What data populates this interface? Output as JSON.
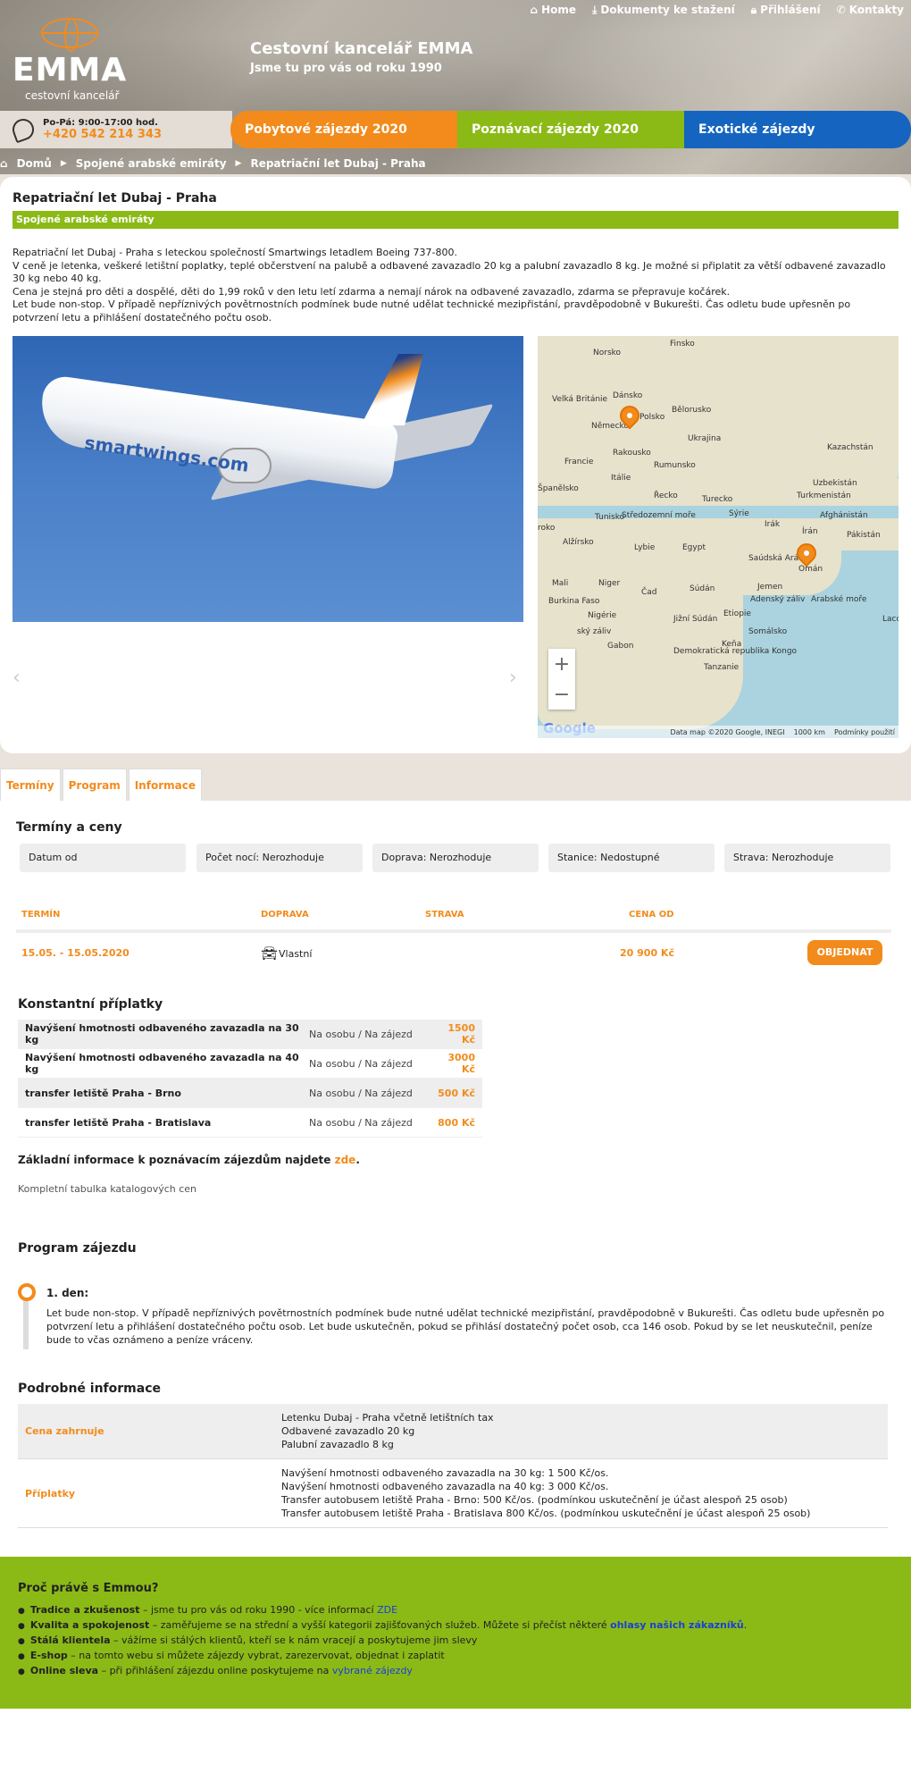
{
  "topnav": [
    {
      "label": "Home",
      "icon": "home-icon"
    },
    {
      "label": "Dokumenty ke stažení",
      "icon": "download-icon"
    },
    {
      "label": "Přihlášení",
      "icon": "lock-icon"
    },
    {
      "label": "Kontakty",
      "icon": "phone-icon"
    }
  ],
  "logo": {
    "word": "EMMA",
    "sub": "cestovní kancelář"
  },
  "header": {
    "title": "Cestovní kancelář EMMA",
    "subtitle": "Jsme tu pro vás od roku 1990"
  },
  "contact": {
    "hours": "Po-Pá: 9:00-17:00 hod.",
    "phone": "+420 542 214 343"
  },
  "mainnav": [
    "Pobytové zájezdy 2020",
    "Poznávací zájezdy 2020",
    "Exotické zájezdy"
  ],
  "crumbs": [
    "Domů",
    "Spojené arabské emiráty",
    "Repatriační let Dubaj - Praha"
  ],
  "page": {
    "title": "Repatriační let Dubaj - Praha",
    "country": "Spojené arabské emiráty",
    "desc": [
      "Repatriační let Dubaj - Praha s leteckou společností Smartwings letadlem Boeing 737-800.",
      "V ceně je letenka, veškeré letištní poplatky, teplé občerstvení na palubě a odbavené zavazadlo 20 kg a palubní zavazadlo 8 kg. Je možné si připlatit za větší odbavené zavazadlo 30 kg nebo 40 kg.",
      "Cena je stejná pro děti a dospělé, děti do 1,99 roků v den letu letí zdarma a nemají nárok na odbavené zavazadlo, zdarma se přepravuje kočárek.",
      "Let bude non-stop. V případě nepříznivých povětrnostních podmínek bude nutné udělat technické mezipřistání, pravděpodobně v Bukurešti. Čas odletu bude upřesněn po potvrzení letu a přihlášení dostatečného počtu osob."
    ]
  },
  "plane": {
    "livery": "smartwings.com"
  },
  "map": {
    "labels": [
      "Finsko",
      "Norsko",
      "Dánsko",
      "Velká Británie",
      "Bělorusko",
      "Německo",
      "Polsko",
      "Ukrajina",
      "Francie",
      "Rakousko",
      "Rumunsko",
      "Kazachstán",
      "Uzbekistán",
      "Španělsko",
      "Itálie",
      "Řecko",
      "Turecko",
      "Turkmenistán",
      "Sýrie",
      "Irák",
      "Afghánistán",
      "Tunisko",
      "Středozemní moře",
      "Írán",
      "Pákistán",
      "roko",
      "Alžírsko",
      "Lybie",
      "Egypt",
      "Saúdská Arábie",
      "Omán",
      "Mali",
      "Niger",
      "Čad",
      "Súdán",
      "Jemen",
      "Burkina Faso",
      "Nigérie",
      "Adenský záliv",
      "Arabské moře",
      "Jižní Súdán",
      "Etiopie",
      "Somálsko",
      "Keňa",
      "Gabon",
      "Demokratická republika Kongo",
      "Tanzanie",
      "Lacca",
      "ský záliv"
    ],
    "footer": [
      "Data map ©2020 Google, INEGI",
      "1000 km",
      "Podmínky použití"
    ],
    "google": "Google",
    "zoom_in": "+",
    "zoom_out": "−"
  },
  "tabs": [
    "Termíny",
    "Program",
    "Informace"
  ],
  "terms": {
    "heading": "Termíny a ceny",
    "filters": [
      "Datum od",
      "Počet nocí: Nerozhoduje",
      "Doprava: Nerozhoduje",
      "Stanice: Nedostupné",
      "Strava: Nerozhoduje"
    ],
    "cols": [
      "TERMÍN",
      "DOPRAVA",
      "STRAVA",
      "CENA OD"
    ],
    "row": {
      "date": "15.05. - 15.05.2020",
      "transport": "Vlastní",
      "price": "20 900 Kč",
      "button": "OBJEDNAT"
    }
  },
  "surcharges": {
    "heading": "Konstantní příplatky",
    "rows": [
      {
        "name": "Navýšení hmotnosti odbaveného zavazadla na 30 kg",
        "unit": "Na osobu / Na zájezd",
        "price": "1500 Kč"
      },
      {
        "name": "Navýšení hmotnosti odbaveného zavazadla na 40 kg",
        "unit": "Na osobu / Na zájezd",
        "price": "3000 Kč"
      },
      {
        "name": "transfer letiště Praha - Brno",
        "unit": "Na osobu / Na zájezd",
        "price": "500 Kč"
      },
      {
        "name": "transfer letiště Praha - Bratislava",
        "unit": "Na osobu / Na zájezd",
        "price": "800 Kč"
      }
    ]
  },
  "basic": {
    "text": "Základní informace k poznávacím zájezdům najdete ",
    "link": "zde",
    "end": "."
  },
  "katalog": "Kompletní tabulka katalogových cen",
  "program": {
    "heading": "Program zájezdu",
    "day": "1. den:",
    "text": "Let bude non-stop. V případě nepříznivých povětrnostních podmínek bude nutné udělat technické mezipřistání, pravděpodobně v Bukurešti. Čas odletu bude upřesněn po potvrzení letu a přihlášení dostatečného počtu osob. Let bude uskutečněn, pokud se přihlásí dostatečný počet osob, cca 146 osob. Pokud by se let neuskutečnil, peníze bude to včas oznámeno a peníze vráceny."
  },
  "info": {
    "heading": "Podrobné informace",
    "rows": [
      {
        "key": "Cena zahrnuje",
        "lines": [
          "Letenku Dubaj - Praha včetně letištních tax",
          "Odbavené zavazadlo 20 kg",
          "Palubní zavazadlo 8 kg"
        ]
      },
      {
        "key": "Příplatky",
        "lines": [
          "Navýšení hmotnosti odbaveného zavazadla na 30 kg: 1 500 Kč/os.",
          "Navýšení hmotnosti odbaveného zavazadla na 40 kg: 3 000 Kč/os.",
          "Transfer autobusem letiště Praha - Brno: 500 Kč/os. (podmínkou uskutečnění je účast alespoň 25 osob)",
          "Transfer autobusem letiště Praha - Bratislava 800 Kč/os. (podmínkou uskutečnění je účast alespoň 25 osob)"
        ]
      }
    ]
  },
  "why": {
    "heading": "Proč právě s Emmou?",
    "items": [
      {
        "b": "Tradice a zkušenost",
        "t": " – jsme tu pro vás od roku 1990 - více informací ",
        "link": "ZDE",
        "t2": ""
      },
      {
        "b": "Kvalita a spokojenost",
        "t": " – zaměřujeme se na střední a vyšší kategorii zajišťovaných služeb. Můžete si přečíst některé ",
        "link": "ohlasy našich zákazníků",
        "t2": "."
      },
      {
        "b": "Stálá klientela",
        "t": " – vážíme si stálých klientů, kteří se k nám vracejí a poskytujeme jim slevy",
        "link": "",
        "t2": ""
      },
      {
        "b": "E-shop",
        "t": " – na tomto webu si můžete zájezdy vybrat, zarezervovat, objednat i zaplatit",
        "link": "",
        "t2": ""
      },
      {
        "b": "Online sleva",
        "t": " – při přihlášení zájezdu online poskytujeme na ",
        "link": "vybrané zájezdy",
        "t2": ""
      }
    ]
  },
  "colors": {
    "orange": "#f28b1c",
    "green": "#8bba16",
    "blue": "#1565c0"
  }
}
